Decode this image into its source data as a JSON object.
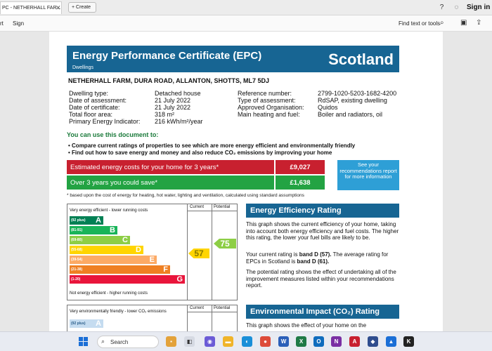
{
  "browser": {
    "tab_title": "PC - NETHERHALL FAR...",
    "new_tab_label": "Create",
    "sign_in": "Sign in"
  },
  "toolbar": {
    "left_items": [
      "rt",
      "Sign"
    ],
    "find_label": "Find text or tools"
  },
  "epc": {
    "title": "Energy Performance Certificate (EPC)",
    "subtitle": "Dwellings",
    "country": "Scotland",
    "address": "NETHERHALL FARM, DURA ROAD, ALLANTON, SHOTTS, ML7 5DJ",
    "details_left": [
      {
        "label": "Dwelling type:",
        "value": "Detached house"
      },
      {
        "label": "Date of assessment:",
        "value": "21 July 2022"
      },
      {
        "label": "Date of certificate:",
        "value": "21 July 2022"
      },
      {
        "label": "Total floor area:",
        "value": "318 m²"
      },
      {
        "label": "Primary Energy Indicator:",
        "value": "216 kWh/m²/year"
      }
    ],
    "details_right": [
      {
        "label": "Reference number:",
        "value": "2799-1020-5203-1682-4200"
      },
      {
        "label": "Type of assessment:",
        "value": "RdSAP, existing dwelling"
      },
      {
        "label": "Approved Organisation:",
        "value": "Quidos"
      },
      {
        "label": "Main heating and fuel:",
        "value": "Boiler and radiators, oil"
      }
    ],
    "use_title": "You can use this document to:",
    "bullets": [
      "Compare current ratings of properties to see which are more energy efficient and environmentally friendly",
      "Find out how to save energy and money and also reduce CO₂ emissions by improving your home"
    ],
    "costs": [
      {
        "label": "Estimated energy costs for your home for 3 years*",
        "value": "£9,027",
        "color": "#c8202f"
      },
      {
        "label": "Over 3 years you could save*",
        "value": "£1,638",
        "color": "#23a343"
      }
    ],
    "see_your": "See your recommendations report for more information",
    "footnote": "* based upon the cost of energy for heating, hot water, lighting and ventilation, calculated using standard assumptions",
    "chart": {
      "top_caption": "Very energy efficient - lower running costs",
      "bottom_caption": "Not energy efficient - higher running costs",
      "col_current": "Current",
      "col_potential": "Potential",
      "bands": [
        {
          "range": "(92 plus)",
          "letter": "A",
          "color": "#008054"
        },
        {
          "range": "(81-91)",
          "letter": "B",
          "color": "#19b459"
        },
        {
          "range": "(69-80)",
          "letter": "C",
          "color": "#8dce46"
        },
        {
          "range": "(55-68)",
          "letter": "D",
          "color": "#ffd500"
        },
        {
          "range": "(39-54)",
          "letter": "E",
          "color": "#fcaa65"
        },
        {
          "range": "(21-38)",
          "letter": "F",
          "color": "#ef8023"
        },
        {
          "range": "(1-20)",
          "letter": "G",
          "color": "#e9153b"
        }
      ],
      "current": "57",
      "potential": "75",
      "current_color": "#ffd500",
      "potential_color": "#8dce46"
    },
    "chart2": {
      "top_caption": "Very environmentally friendly - lower CO₂ emissions",
      "col_current": "Current",
      "col_potential": "Potential",
      "first_range": "(92 plus)",
      "first_letter": "A"
    },
    "eer_title": "Energy Efficiency Rating",
    "eer_p1": "This graph shows the current efficiency of your home, taking into account both energy efficiency and fuel costs. The higher this rating, the lower your fuel bills are likely to be.",
    "eer_p2_pre": "Your current rating is ",
    "eer_p2_bold1": "band D (57).",
    "eer_p2_mid": " The average rating for EPCs in Scotland is ",
    "eer_p2_bold2": "band D (61).",
    "eer_p3": "The potential rating shows the effect of undertaking all of the improvement measures listed within your recommendations report.",
    "eir_title": "Environmental Impact (CO₂) Rating",
    "eir_p1": "This graph shows the effect of your home on the"
  },
  "taskbar": {
    "search_label": "Search"
  }
}
